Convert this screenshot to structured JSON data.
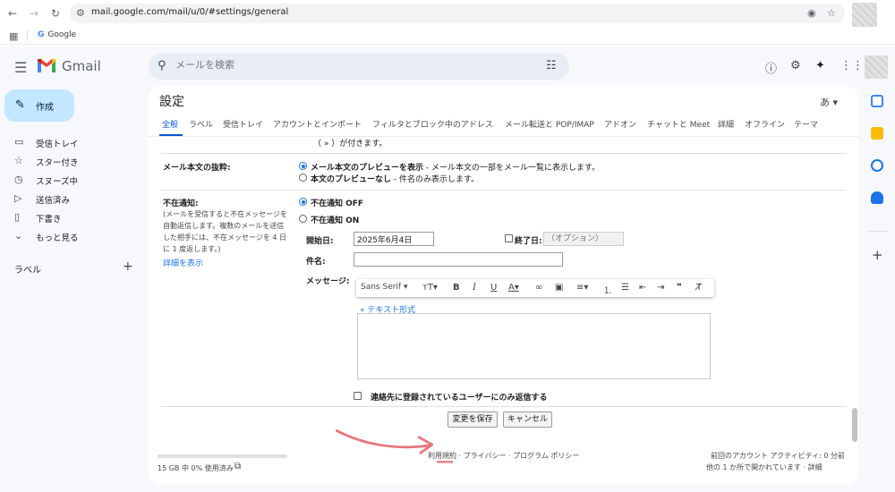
{
  "browser": {
    "url": "mail.google.com/mail/u/0/#settings/general",
    "bookmark_google": "Google"
  },
  "header": {
    "app_name": "Gmail",
    "search_placeholder": "メールを検索",
    "input_tools_label": "あ ▾"
  },
  "sidebar": {
    "compose_label": "作成",
    "items": [
      {
        "label": "受信トレイ",
        "icon": "inbox-icon"
      },
      {
        "label": "スター付き",
        "icon": "star-icon"
      },
      {
        "label": "スヌーズ中",
        "icon": "clock-icon"
      },
      {
        "label": "送信済み",
        "icon": "send-icon"
      },
      {
        "label": "下書き",
        "icon": "draft-icon"
      },
      {
        "label": "もっと見る",
        "icon": "chevron-down-icon"
      }
    ],
    "labels_heading": "ラベル",
    "labels_add": "+"
  },
  "settings": {
    "title": "設定",
    "tabs": [
      "全般",
      "ラベル",
      "受信トレイ",
      "アカウントとインポート",
      "フィルタとブロック中のアドレス",
      "メール転送と POP/IMAP",
      "アドオン",
      "チャットと Meet",
      "詳細",
      "オフライン",
      "テーマ"
    ],
    "top_note": "（ » ）が付きます。",
    "snippets": {
      "label": "メール本文の抜粋:",
      "opt1_bold": "メール本文のプレビューを表示",
      "opt1_desc": " - メール本文の一部をメール一覧に表示します。",
      "opt2_bold": "本文のプレビューなし",
      "opt2_desc": " - 件名のみ表示します。"
    },
    "vacation": {
      "label": "不在通知:",
      "description": "(メールを受信すると不在メッセージを自動返信します。複数のメールを送信した相手には、不在メッセージを 4 日に 1 度返します。)",
      "learn_more": "詳細を表示",
      "off_label": "不在通知 OFF",
      "on_label": "不在通知 ON",
      "start_label": "開始日:",
      "start_value": "2025年6月4日",
      "end_label": "終了日:",
      "end_placeholder": "（オプション）",
      "subject_label": "件名:",
      "subject_value": "",
      "message_label": "メッセージ:",
      "plain_text_link": "« テキスト形式",
      "contacts_only": "連絡先に登録されているユーザーにのみ返信する"
    },
    "toolbar": {
      "font": "Sans Serif ▾"
    },
    "save_button": "変更を保存",
    "cancel_button": "キャンセル"
  },
  "footer": {
    "storage": "15 GB 中 0% 使用済み",
    "links": "利用規約 · プライバシー · プログラム ポリシー",
    "activity_1": "前回のアカウント アクティビティ: 0 分前",
    "activity_2": "他の 1 か所で開かれています · 詳細"
  },
  "colors": {
    "accent": "#0b57d0",
    "compose_bg": "#c2e7ff",
    "annotation_arrow": "#e8747c"
  }
}
